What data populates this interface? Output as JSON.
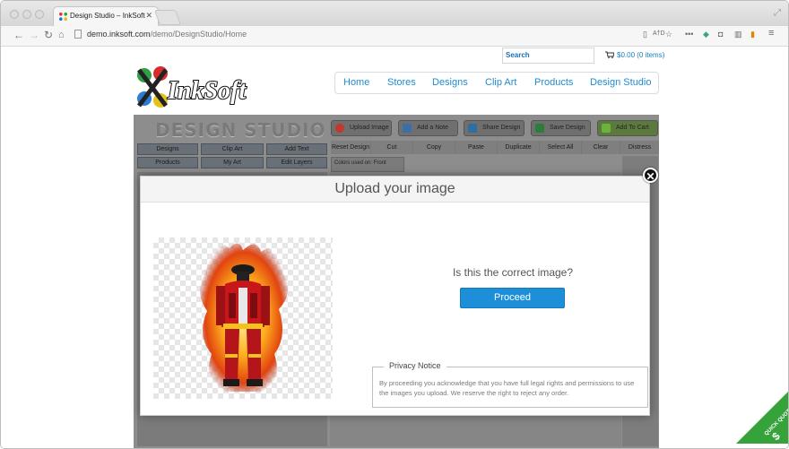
{
  "browser": {
    "tab_title": "Design Studio – InkSoft Or",
    "url_host": "demo.inksoft.com",
    "url_path": "/demo/DesignStudio/Home",
    "ext_badge": "A†D"
  },
  "site": {
    "logo_text": "InkSoft",
    "search_placeholder": "Search",
    "cart_label": "$0.00 (0 items)",
    "nav": [
      "Home",
      "Stores",
      "Designs",
      "Clip Art",
      "Products",
      "Design Studio"
    ]
  },
  "studio": {
    "title": "DESIGN STUDIO",
    "actions": [
      "Upload Image",
      "Add a Note",
      "Share Design",
      "Save Design",
      "Add To Cart"
    ],
    "left_buttons": [
      "Designs",
      "Clip Art",
      "Add Text",
      "Products",
      "My Art",
      "Edit Layers"
    ],
    "tools": [
      "Reset Design",
      "Cut",
      "Copy",
      "Paste",
      "Duplicate",
      "Select All",
      "Clear",
      "Distress"
    ],
    "colors_tab": "Colors used on: Front"
  },
  "modal": {
    "title": "Upload your image",
    "question": "Is this the correct image?",
    "proceed_label": "Proceed",
    "privacy_title": "Privacy Notice",
    "privacy_text": "By proceeding you acknowledge that you have full legal rights and permissions to use the images you upload. We reserve the right to reject any order."
  },
  "quick_quote": "QUICK QUOTE",
  "colors": {
    "accent": "#1d8fd8",
    "nav_link": "#1d8cd1",
    "add_to_cart": "#6bb33a"
  }
}
